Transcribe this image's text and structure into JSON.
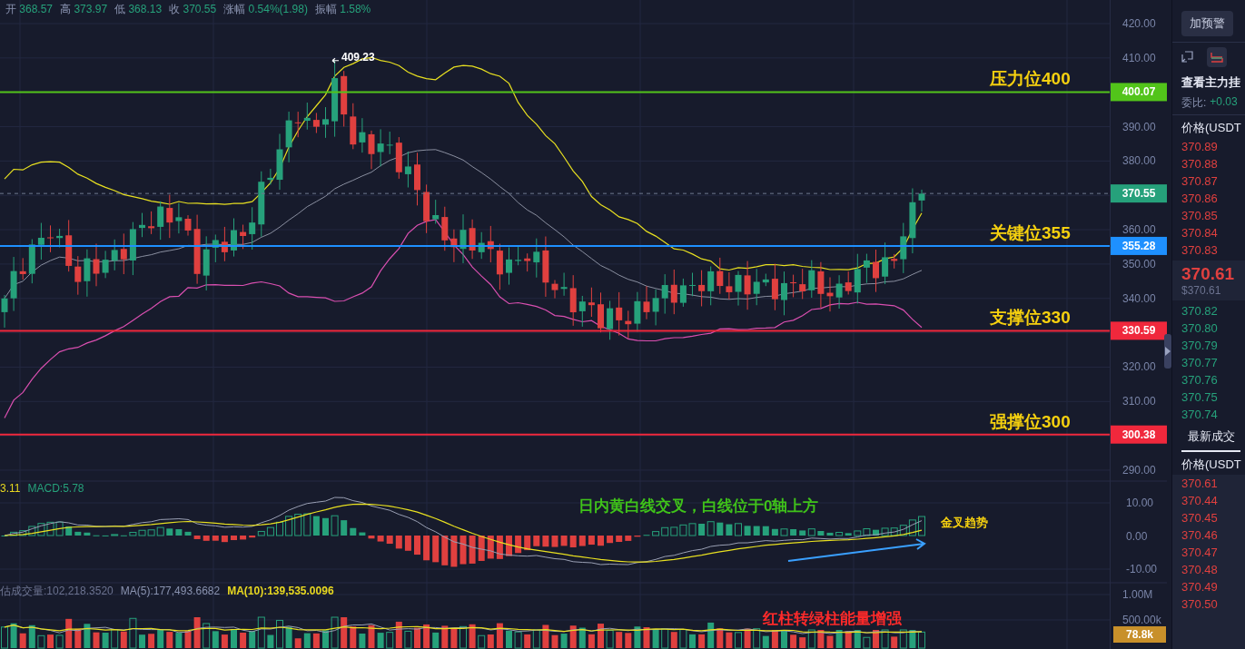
{
  "chart": {
    "stats": [
      {
        "label": "开",
        "value": "368.57"
      },
      {
        "label": "高",
        "value": "373.97"
      },
      {
        "label": "低",
        "value": "368.13"
      },
      {
        "label": "收",
        "value": "370.55"
      },
      {
        "label": "涨幅",
        "value": "0.54%(1.98)"
      },
      {
        "label": "振幅",
        "value": "1.58%"
      }
    ],
    "price_axis": [
      "420.00",
      "410.00",
      "390.00",
      "380.00",
      "360.00",
      "350.00",
      "340.00",
      "320.00",
      "310.00",
      "290.00"
    ],
    "high_marker": "409.23",
    "last_price_tag": "370.55",
    "levels": [
      {
        "label": "压力位400",
        "price_tag": "400.07",
        "color": "#52c41a"
      },
      {
        "label": "关键位355",
        "price_tag": "355.28",
        "color": "#1e90ff"
      },
      {
        "label": "支撑位330",
        "price_tag": "330.59",
        "color": "#f0283c"
      },
      {
        "label": "强撑位300",
        "price_tag": "300.38",
        "color": "#f0283c"
      }
    ]
  },
  "macd": {
    "legend": [
      {
        "text": "3.11",
        "color": "#e8d820"
      },
      {
        "text": "MACD:5.78",
        "color": "#26a17b"
      }
    ],
    "axis": [
      "10.00",
      "0.00",
      "-10.00"
    ],
    "note": "日内黄白线交叉，白线位于0轴上方",
    "trend_label": "金叉趋势"
  },
  "volume": {
    "legend": [
      {
        "text": "估成交量:102,218.3520",
        "color": "#6c7390"
      },
      {
        "text": "MA(5):177,493.6682",
        "color": "#8a93b0"
      },
      {
        "text": "MA(10):139,535.0096",
        "color": "#e8d820"
      }
    ],
    "axis": [
      "1.00M",
      "500.00k"
    ],
    "tag": "78.8k",
    "note": "红柱转绿柱能量增强"
  },
  "side_panel": {
    "alert_button": "加预警",
    "view_buttons": [
      {
        "kind": "expand",
        "selected": false
      },
      {
        "kind": "depth",
        "selected": true
      }
    ],
    "main_orders_label": "查看主力挂",
    "ratio_label": "委比:",
    "ratio_value": "+0.03",
    "price_header": "价格(USDT",
    "asks": [
      "370.89",
      "370.88",
      "370.87",
      "370.86",
      "370.85",
      "370.84",
      "370.83"
    ],
    "last_price": "370.61",
    "last_price_usd": "$370.61",
    "bids": [
      "370.82",
      "370.80",
      "370.79",
      "370.77",
      "370.76",
      "370.75",
      "370.74"
    ],
    "trades_tab": {
      "label": "最新成交",
      "selected": true
    },
    "trades_header": "价格(USDT",
    "trades": [
      "370.61",
      "370.44",
      "370.45",
      "370.46",
      "370.47",
      "370.48",
      "370.49",
      "370.50"
    ]
  }
}
